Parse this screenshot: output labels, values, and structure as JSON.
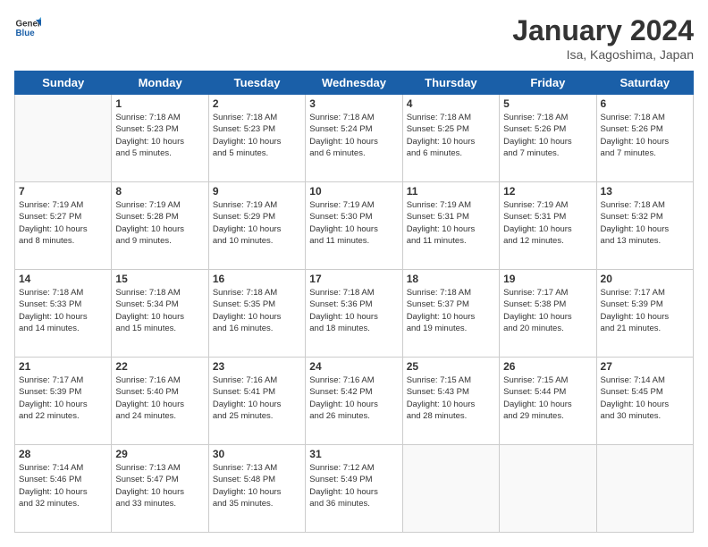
{
  "header": {
    "logo_line1": "General",
    "logo_line2": "Blue",
    "month_title": "January 2024",
    "location": "Isa, Kagoshima, Japan"
  },
  "weekdays": [
    "Sunday",
    "Monday",
    "Tuesday",
    "Wednesday",
    "Thursday",
    "Friday",
    "Saturday"
  ],
  "weeks": [
    [
      {
        "day": "",
        "info": ""
      },
      {
        "day": "1",
        "info": "Sunrise: 7:18 AM\nSunset: 5:23 PM\nDaylight: 10 hours\nand 5 minutes."
      },
      {
        "day": "2",
        "info": "Sunrise: 7:18 AM\nSunset: 5:23 PM\nDaylight: 10 hours\nand 5 minutes."
      },
      {
        "day": "3",
        "info": "Sunrise: 7:18 AM\nSunset: 5:24 PM\nDaylight: 10 hours\nand 6 minutes."
      },
      {
        "day": "4",
        "info": "Sunrise: 7:18 AM\nSunset: 5:25 PM\nDaylight: 10 hours\nand 6 minutes."
      },
      {
        "day": "5",
        "info": "Sunrise: 7:18 AM\nSunset: 5:26 PM\nDaylight: 10 hours\nand 7 minutes."
      },
      {
        "day": "6",
        "info": "Sunrise: 7:18 AM\nSunset: 5:26 PM\nDaylight: 10 hours\nand 7 minutes."
      }
    ],
    [
      {
        "day": "7",
        "info": "Sunrise: 7:19 AM\nSunset: 5:27 PM\nDaylight: 10 hours\nand 8 minutes."
      },
      {
        "day": "8",
        "info": "Sunrise: 7:19 AM\nSunset: 5:28 PM\nDaylight: 10 hours\nand 9 minutes."
      },
      {
        "day": "9",
        "info": "Sunrise: 7:19 AM\nSunset: 5:29 PM\nDaylight: 10 hours\nand 10 minutes."
      },
      {
        "day": "10",
        "info": "Sunrise: 7:19 AM\nSunset: 5:30 PM\nDaylight: 10 hours\nand 11 minutes."
      },
      {
        "day": "11",
        "info": "Sunrise: 7:19 AM\nSunset: 5:31 PM\nDaylight: 10 hours\nand 11 minutes."
      },
      {
        "day": "12",
        "info": "Sunrise: 7:19 AM\nSunset: 5:31 PM\nDaylight: 10 hours\nand 12 minutes."
      },
      {
        "day": "13",
        "info": "Sunrise: 7:18 AM\nSunset: 5:32 PM\nDaylight: 10 hours\nand 13 minutes."
      }
    ],
    [
      {
        "day": "14",
        "info": "Sunrise: 7:18 AM\nSunset: 5:33 PM\nDaylight: 10 hours\nand 14 minutes."
      },
      {
        "day": "15",
        "info": "Sunrise: 7:18 AM\nSunset: 5:34 PM\nDaylight: 10 hours\nand 15 minutes."
      },
      {
        "day": "16",
        "info": "Sunrise: 7:18 AM\nSunset: 5:35 PM\nDaylight: 10 hours\nand 16 minutes."
      },
      {
        "day": "17",
        "info": "Sunrise: 7:18 AM\nSunset: 5:36 PM\nDaylight: 10 hours\nand 18 minutes."
      },
      {
        "day": "18",
        "info": "Sunrise: 7:18 AM\nSunset: 5:37 PM\nDaylight: 10 hours\nand 19 minutes."
      },
      {
        "day": "19",
        "info": "Sunrise: 7:17 AM\nSunset: 5:38 PM\nDaylight: 10 hours\nand 20 minutes."
      },
      {
        "day": "20",
        "info": "Sunrise: 7:17 AM\nSunset: 5:39 PM\nDaylight: 10 hours\nand 21 minutes."
      }
    ],
    [
      {
        "day": "21",
        "info": "Sunrise: 7:17 AM\nSunset: 5:39 PM\nDaylight: 10 hours\nand 22 minutes."
      },
      {
        "day": "22",
        "info": "Sunrise: 7:16 AM\nSunset: 5:40 PM\nDaylight: 10 hours\nand 24 minutes."
      },
      {
        "day": "23",
        "info": "Sunrise: 7:16 AM\nSunset: 5:41 PM\nDaylight: 10 hours\nand 25 minutes."
      },
      {
        "day": "24",
        "info": "Sunrise: 7:16 AM\nSunset: 5:42 PM\nDaylight: 10 hours\nand 26 minutes."
      },
      {
        "day": "25",
        "info": "Sunrise: 7:15 AM\nSunset: 5:43 PM\nDaylight: 10 hours\nand 28 minutes."
      },
      {
        "day": "26",
        "info": "Sunrise: 7:15 AM\nSunset: 5:44 PM\nDaylight: 10 hours\nand 29 minutes."
      },
      {
        "day": "27",
        "info": "Sunrise: 7:14 AM\nSunset: 5:45 PM\nDaylight: 10 hours\nand 30 minutes."
      }
    ],
    [
      {
        "day": "28",
        "info": "Sunrise: 7:14 AM\nSunset: 5:46 PM\nDaylight: 10 hours\nand 32 minutes."
      },
      {
        "day": "29",
        "info": "Sunrise: 7:13 AM\nSunset: 5:47 PM\nDaylight: 10 hours\nand 33 minutes."
      },
      {
        "day": "30",
        "info": "Sunrise: 7:13 AM\nSunset: 5:48 PM\nDaylight: 10 hours\nand 35 minutes."
      },
      {
        "day": "31",
        "info": "Sunrise: 7:12 AM\nSunset: 5:49 PM\nDaylight: 10 hours\nand 36 minutes."
      },
      {
        "day": "",
        "info": ""
      },
      {
        "day": "",
        "info": ""
      },
      {
        "day": "",
        "info": ""
      }
    ]
  ]
}
